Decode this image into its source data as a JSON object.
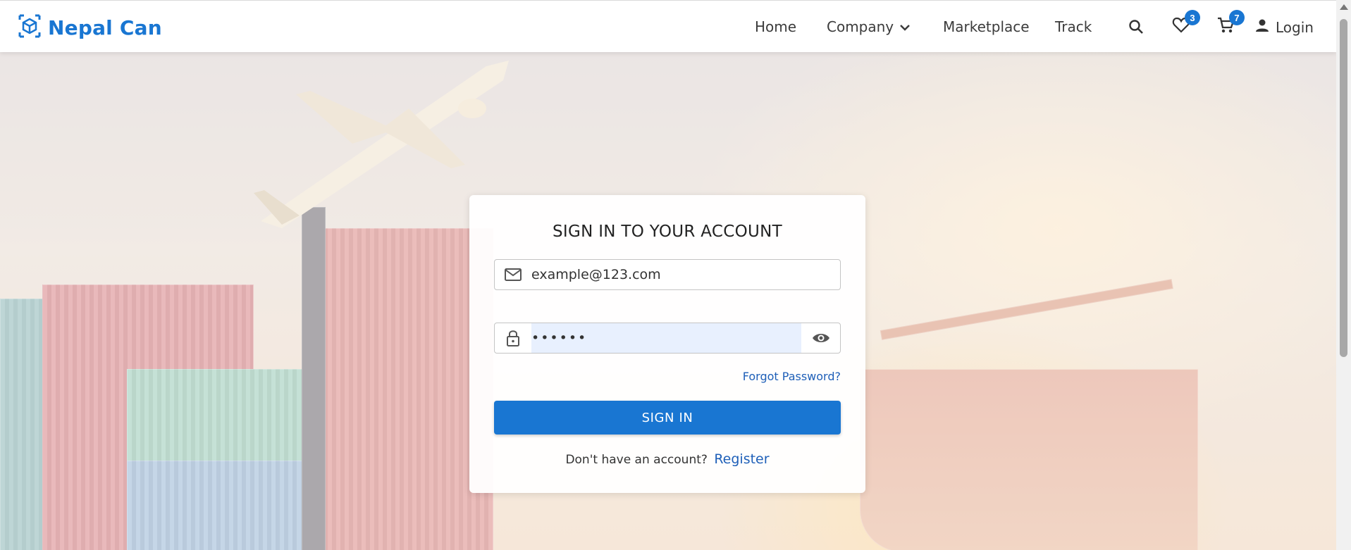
{
  "header": {
    "brand": "Nepal Can",
    "nav": {
      "home": "Home",
      "company": "Company",
      "marketplace": "Marketplace",
      "track": "Track"
    },
    "wishlist_count": "3",
    "cart_count": "7",
    "login": "Login"
  },
  "form": {
    "title": "SIGN IN TO YOUR ACCOUNT",
    "email_value": "example@123.com",
    "password_value": "••••••",
    "forgot": "Forgot Password?",
    "submit": "SIGN IN",
    "no_account": "Don't have an account?",
    "register": "Register"
  },
  "colors": {
    "accent": "#1976d2",
    "link": "#1e5fb8",
    "autofill": "#e8f0fe"
  },
  "icons": [
    "cube-logo-icon",
    "chevron-down-icon",
    "search-icon",
    "heart-icon",
    "cart-icon",
    "person-icon",
    "mail-icon",
    "lock-icon",
    "eye-icon"
  ]
}
